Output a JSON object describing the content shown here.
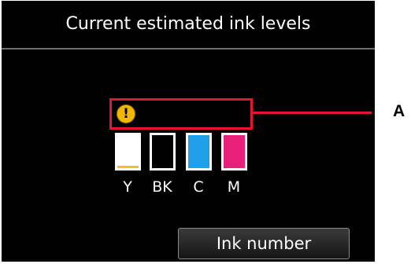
{
  "screen": {
    "title": "Current estimated ink levels"
  },
  "warning": {
    "icon": "exclamation-warning-icon",
    "glyph": "!"
  },
  "callout": {
    "label": "A"
  },
  "ink_tanks": [
    {
      "label": "Y",
      "color": "#f0c020",
      "level": 0.06
    },
    {
      "label": "BK",
      "color": "#000000",
      "level": 1.0
    },
    {
      "label": "C",
      "color": "#1e9fe8",
      "level": 1.0
    },
    {
      "label": "M",
      "color": "#e8207a",
      "level": 1.0
    }
  ],
  "buttons": {
    "ink_number": "Ink number"
  }
}
